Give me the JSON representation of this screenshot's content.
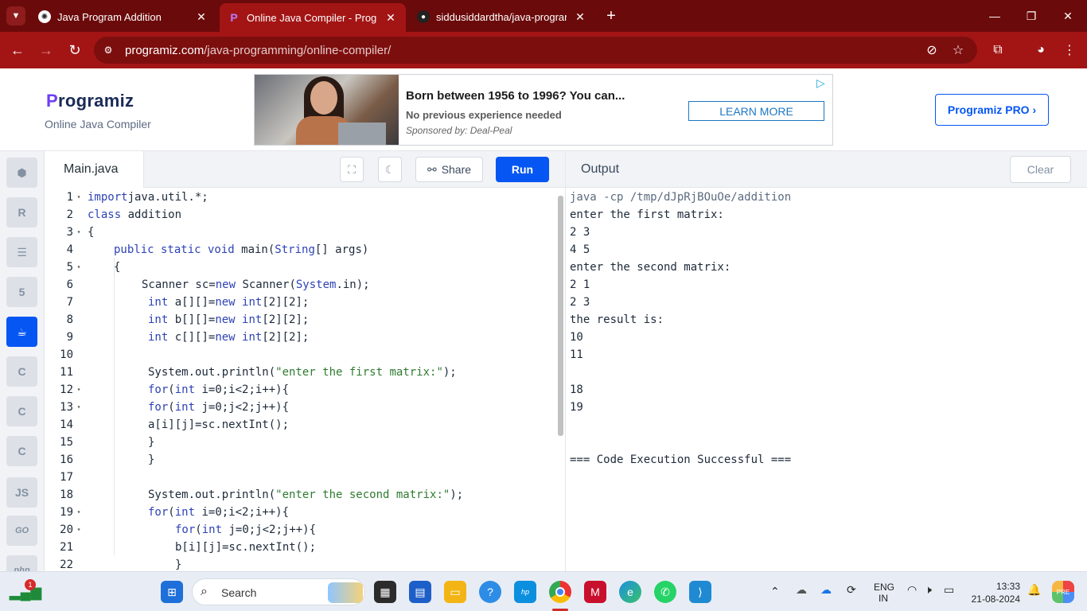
{
  "browser": {
    "tabs": [
      {
        "title": "Java Program Addition",
        "icon": "chatgpt-icon"
      },
      {
        "title": "Online Java Compiler - Program",
        "icon": "programiz-icon"
      },
      {
        "title": "siddusiddardtha/java-programm",
        "icon": "github-icon"
      }
    ],
    "url_host": "programiz.com",
    "url_path": "/java-programming/online-compiler/"
  },
  "header": {
    "logo_p": "P",
    "logo_rest": "rogramiz",
    "subtitle": "Online Java Compiler",
    "pro_button": "Programiz PRO ›"
  },
  "ad": {
    "headline": "Born between 1956 to 1996? You can...",
    "subline": "No previous experience needed",
    "sponsor": "Sponsored by: Deal-Peal",
    "cta": "LEARN MORE"
  },
  "sidebar": {
    "langs": [
      "python-icon",
      "r-icon",
      "sql-icon",
      "html5-icon",
      "java-icon",
      "c-icon",
      "cpp-icon",
      "csharp-icon",
      "js-icon",
      "go-icon",
      "php-icon"
    ],
    "js_label": "JS",
    "go_label": "GO",
    "php_label": "php"
  },
  "editor": {
    "filename": "Main.java",
    "share_label": "Share",
    "run_label": "Run",
    "lines": [
      {
        "n": "1",
        "fold": true,
        "indent": 0,
        "parts": [
          [
            "kw",
            "import"
          ],
          [
            "",
            "java.util.*;"
          ]
        ]
      },
      {
        "n": "2",
        "fold": false,
        "indent": 0,
        "parts": [
          [
            "kw",
            "class"
          ],
          [
            "",
            " addition"
          ]
        ]
      },
      {
        "n": "3",
        "fold": true,
        "indent": 0,
        "parts": [
          [
            "",
            "{"
          ]
        ]
      },
      {
        "n": "4",
        "fold": false,
        "indent": 33,
        "parts": [
          [
            "kw",
            "public static void"
          ],
          [
            "",
            " main("
          ],
          [
            "ty",
            "String"
          ],
          [
            "",
            "[] args)"
          ]
        ]
      },
      {
        "n": "5",
        "fold": true,
        "indent": 33,
        "parts": [
          [
            "",
            "{"
          ]
        ]
      },
      {
        "n": "6",
        "fold": false,
        "indent": 68,
        "parts": [
          [
            "",
            "Scanner sc="
          ],
          [
            "kw",
            "new"
          ],
          [
            "",
            " Scanner("
          ],
          [
            "ty",
            "System"
          ],
          [
            "",
            ".in);"
          ]
        ]
      },
      {
        "n": "7",
        "fold": false,
        "indent": 76,
        "parts": [
          [
            "kw",
            "int"
          ],
          [
            "",
            " a[][]="
          ],
          [
            "kw",
            "new"
          ],
          [
            "",
            " "
          ],
          [
            "kw",
            "int"
          ],
          [
            "",
            "[2][2];"
          ]
        ]
      },
      {
        "n": "8",
        "fold": false,
        "indent": 76,
        "parts": [
          [
            "kw",
            "int"
          ],
          [
            "",
            " b[][]="
          ],
          [
            "kw",
            "new"
          ],
          [
            "",
            " "
          ],
          [
            "kw",
            "int"
          ],
          [
            "",
            "[2][2];"
          ]
        ]
      },
      {
        "n": "9",
        "fold": false,
        "indent": 76,
        "parts": [
          [
            "kw",
            "int"
          ],
          [
            "",
            " c[][]="
          ],
          [
            "kw",
            "new"
          ],
          [
            "",
            " "
          ],
          [
            "kw",
            "int"
          ],
          [
            "",
            "[2][2];"
          ]
        ]
      },
      {
        "n": "10",
        "fold": false,
        "indent": 76,
        "parts": []
      },
      {
        "n": "11",
        "fold": false,
        "indent": 76,
        "parts": [
          [
            "",
            "System.out.println("
          ],
          [
            "str",
            "\"enter the first matrix:\""
          ],
          [
            "",
            ");"
          ]
        ]
      },
      {
        "n": "12",
        "fold": true,
        "indent": 76,
        "parts": [
          [
            "kw",
            "for"
          ],
          [
            "",
            "("
          ],
          [
            "kw",
            "int"
          ],
          [
            "",
            " i=0;i<2;i++){"
          ]
        ]
      },
      {
        "n": "13",
        "fold": true,
        "indent": 76,
        "parts": [
          [
            "kw",
            "for"
          ],
          [
            "",
            "("
          ],
          [
            "kw",
            "int"
          ],
          [
            "",
            " j=0;j<2;j++){"
          ]
        ]
      },
      {
        "n": "14",
        "fold": false,
        "indent": 76,
        "parts": [
          [
            "",
            "a[i][j]=sc.nextInt();"
          ]
        ]
      },
      {
        "n": "15",
        "fold": false,
        "indent": 76,
        "parts": [
          [
            "",
            "}"
          ]
        ]
      },
      {
        "n": "16",
        "fold": false,
        "indent": 76,
        "parts": [
          [
            "",
            "}"
          ]
        ]
      },
      {
        "n": "17",
        "fold": false,
        "indent": 76,
        "parts": []
      },
      {
        "n": "18",
        "fold": false,
        "indent": 76,
        "parts": [
          [
            "",
            "System.out.println("
          ],
          [
            "str",
            "\"enter the second matrix:\""
          ],
          [
            "",
            ");"
          ]
        ]
      },
      {
        "n": "19",
        "fold": true,
        "indent": 76,
        "parts": [
          [
            "kw",
            "for"
          ],
          [
            "",
            "("
          ],
          [
            "kw",
            "int"
          ],
          [
            "",
            " i=0;i<2;i++){"
          ]
        ]
      },
      {
        "n": "20",
        "fold": true,
        "indent": 110,
        "parts": [
          [
            "kw",
            "for"
          ],
          [
            "",
            "("
          ],
          [
            "kw",
            "int"
          ],
          [
            "",
            " j=0;j<2;j++){"
          ]
        ]
      },
      {
        "n": "21",
        "fold": false,
        "indent": 110,
        "parts": [
          [
            "",
            "b[i][j]=sc.nextInt();"
          ]
        ]
      },
      {
        "n": "22",
        "fold": false,
        "indent": 110,
        "parts": [
          [
            "",
            "}"
          ]
        ]
      }
    ]
  },
  "output": {
    "title": "Output",
    "clear_label": "Clear",
    "lines": [
      "java -cp /tmp/dJpRjBOuOe/addition",
      "enter the first matrix:",
      "2 3",
      "4 5",
      "enter the second matrix:",
      "2 1",
      "2 3",
      "the result is:",
      "10",
      "11",
      "",
      "18",
      "19",
      "",
      "",
      "=== Code Execution Successful ==="
    ]
  },
  "taskbar": {
    "search_placeholder": "Search",
    "notif_count": "1",
    "lang_top": "ENG",
    "lang_bottom": "IN",
    "time": "13:33",
    "date": "21-08-2024",
    "pinned": [
      "windows-start-icon",
      "file-manager-icon",
      "store-icon",
      "folder-icon",
      "copilot-icon",
      "hp-icon",
      "chrome-icon",
      "mcafee-icon",
      "edge-icon",
      "whatsapp-icon",
      "vscode-icon"
    ]
  },
  "colors": {
    "accent": "#0556f3",
    "tabstrip": "#6b0a0a",
    "toolbar": "#a31515"
  }
}
